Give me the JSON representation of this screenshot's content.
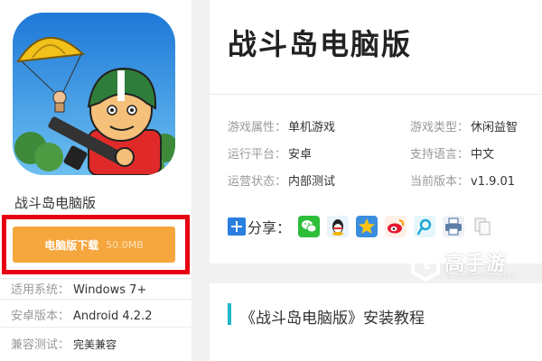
{
  "app": {
    "name": "战斗岛电脑版",
    "download_label": "电脑版下载",
    "download_size": "50.0MB"
  },
  "specs": [
    {
      "label": "适用系统：",
      "value": "Windows 7+"
    },
    {
      "label": "安卓版本：",
      "value": "Android 4.2.2"
    },
    {
      "label": "兼容测试：",
      "value": "完美兼容"
    }
  ],
  "game": {
    "title": "战斗岛电脑版",
    "attributes": [
      {
        "label": "游戏属性：",
        "value": "单机游戏"
      },
      {
        "label": "游戏类型：",
        "value": "休闲益智"
      },
      {
        "label": "运行平台：",
        "value": "安卓"
      },
      {
        "label": "支持语言：",
        "value": "中文"
      },
      {
        "label": "运营状态：",
        "value": "内部测试"
      },
      {
        "label": "当前版本：",
        "value": "v1.9.01"
      }
    ]
  },
  "share": {
    "label": "分享：",
    "icons": [
      "wechat-icon",
      "qq-icon",
      "qzone-icon",
      "weibo-icon",
      "tencent-weibo-icon",
      "print-icon",
      "copy-icon"
    ]
  },
  "watermark": {
    "text": "高手游",
    "sub": "GAOSHOUYOU.COM"
  },
  "tutorial": {
    "title": "《战斗岛电脑版》安装教程"
  },
  "colors": {
    "download_button": "#f5a63d",
    "highlight_frame": "#e60012",
    "accent_bar": "#21b6c8"
  }
}
